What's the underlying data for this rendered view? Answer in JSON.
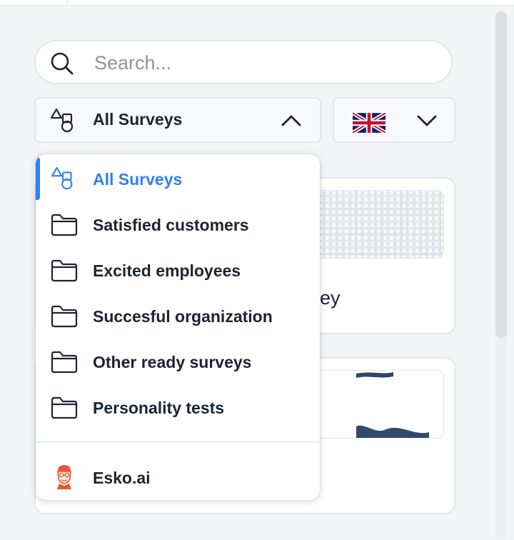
{
  "search": {
    "placeholder": "Search..."
  },
  "filter": {
    "selected_label": "All Surveys",
    "expanded": true
  },
  "language": {
    "flag": "uk-flag-icon"
  },
  "dropdown": {
    "items": [
      {
        "label": "All Surveys",
        "icon": "shapes-icon",
        "active": true
      },
      {
        "label": "Satisfied customers",
        "icon": "folder-icon",
        "active": false
      },
      {
        "label": "Excited employees",
        "icon": "folder-icon",
        "active": false
      },
      {
        "label": "Succesful organization",
        "icon": "folder-icon",
        "active": false
      },
      {
        "label": "Other ready surveys",
        "icon": "folder-icon",
        "active": false
      },
      {
        "label": "Personality tests",
        "icon": "folder-icon",
        "active": false
      }
    ],
    "footer_item": {
      "label": "Esko.ai",
      "icon": "esko-avatar-icon"
    }
  },
  "cards": [
    {
      "title_fragment": "ey"
    },
    {
      "title_fragment": ""
    }
  ],
  "colors": {
    "accent": "#2f80ed",
    "text": "#1c2333",
    "background": "#f2f4f6"
  }
}
